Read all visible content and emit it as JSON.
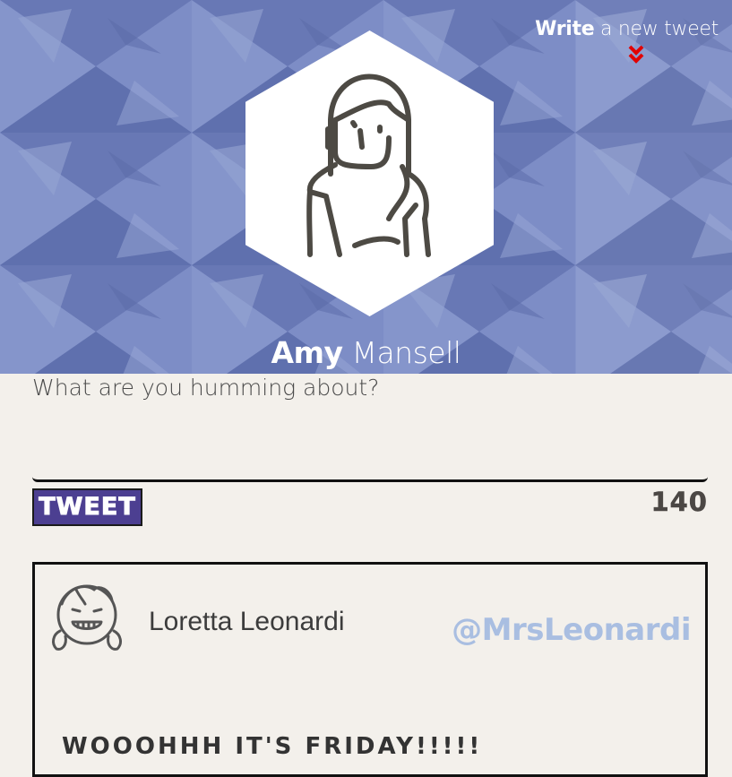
{
  "header": {
    "compose_link": {
      "bold": "Write",
      "rest": "a new tweet"
    },
    "profile": {
      "first_name": "Amy",
      "last_name": "Mansell"
    }
  },
  "composer": {
    "placeholder": "What are you humming about?",
    "value": ""
  },
  "actions": {
    "tweet_label": "TWEET",
    "char_count": "140"
  },
  "feed": [
    {
      "name": "Loretta Leonardi",
      "handle": "@MrsLeonardi",
      "text": "WOOOHHH IT'S FRIDAY!!!!!"
    }
  ],
  "icons": {
    "compose_chevron": "double-chevron-down-icon",
    "profile_avatar": "woman-avatar-icon",
    "feed_avatar": "girl-smiling-avatar-icon"
  },
  "colors": {
    "hero_background": "#7585bf",
    "page_background": "#f3f0eb",
    "tweet_button": "#4c3f91",
    "chevron": "#e10000",
    "handle": "#a9bee1"
  }
}
